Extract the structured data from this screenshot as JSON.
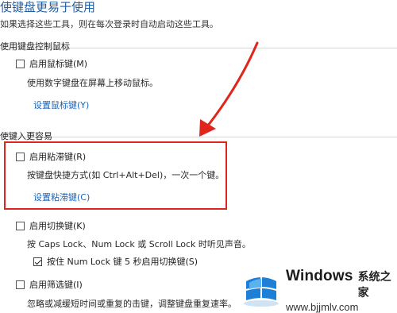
{
  "page": {
    "title": "使键盘更易于使用",
    "description": "如果选择这些工具，则在每次登录时自动启动这些工具。"
  },
  "mouse_section": {
    "title": "使用键盘控制鼠标",
    "option_label": "启用鼠标键(M)",
    "option_checked": false,
    "description": "使用数字键盘在屏幕上移动鼠标。",
    "link": "设置鼠标键(Y)"
  },
  "typing_section": {
    "title": "使键入更容易",
    "sticky": {
      "label": "启用粘滞键(R)",
      "checked": false,
      "description": "按键盘快捷方式(如 Ctrl+Alt+Del)，一次一个键。",
      "link": "设置粘滞键(C)"
    },
    "toggle": {
      "label": "启用切换键(K)",
      "checked": false,
      "description": "按 Caps Lock、Num Lock 或 Scroll Lock 时听见声音。",
      "sub_label": "按住 Num Lock 键 5 秒启用切换键(S)",
      "sub_checked": true
    },
    "filter": {
      "label": "启用筛选键(I)",
      "checked": false,
      "description": "忽略或减缓短时间或重复的击键，调整键盘重复速率。"
    }
  },
  "colors": {
    "highlight": "#e0261c",
    "arrow": "#e0261c",
    "link": "#1a63b8",
    "title": "#1f5fa8"
  },
  "watermark": {
    "brand": "Windows",
    "brand_cn": "系统之家",
    "url": "www.bjjmlv.com"
  }
}
